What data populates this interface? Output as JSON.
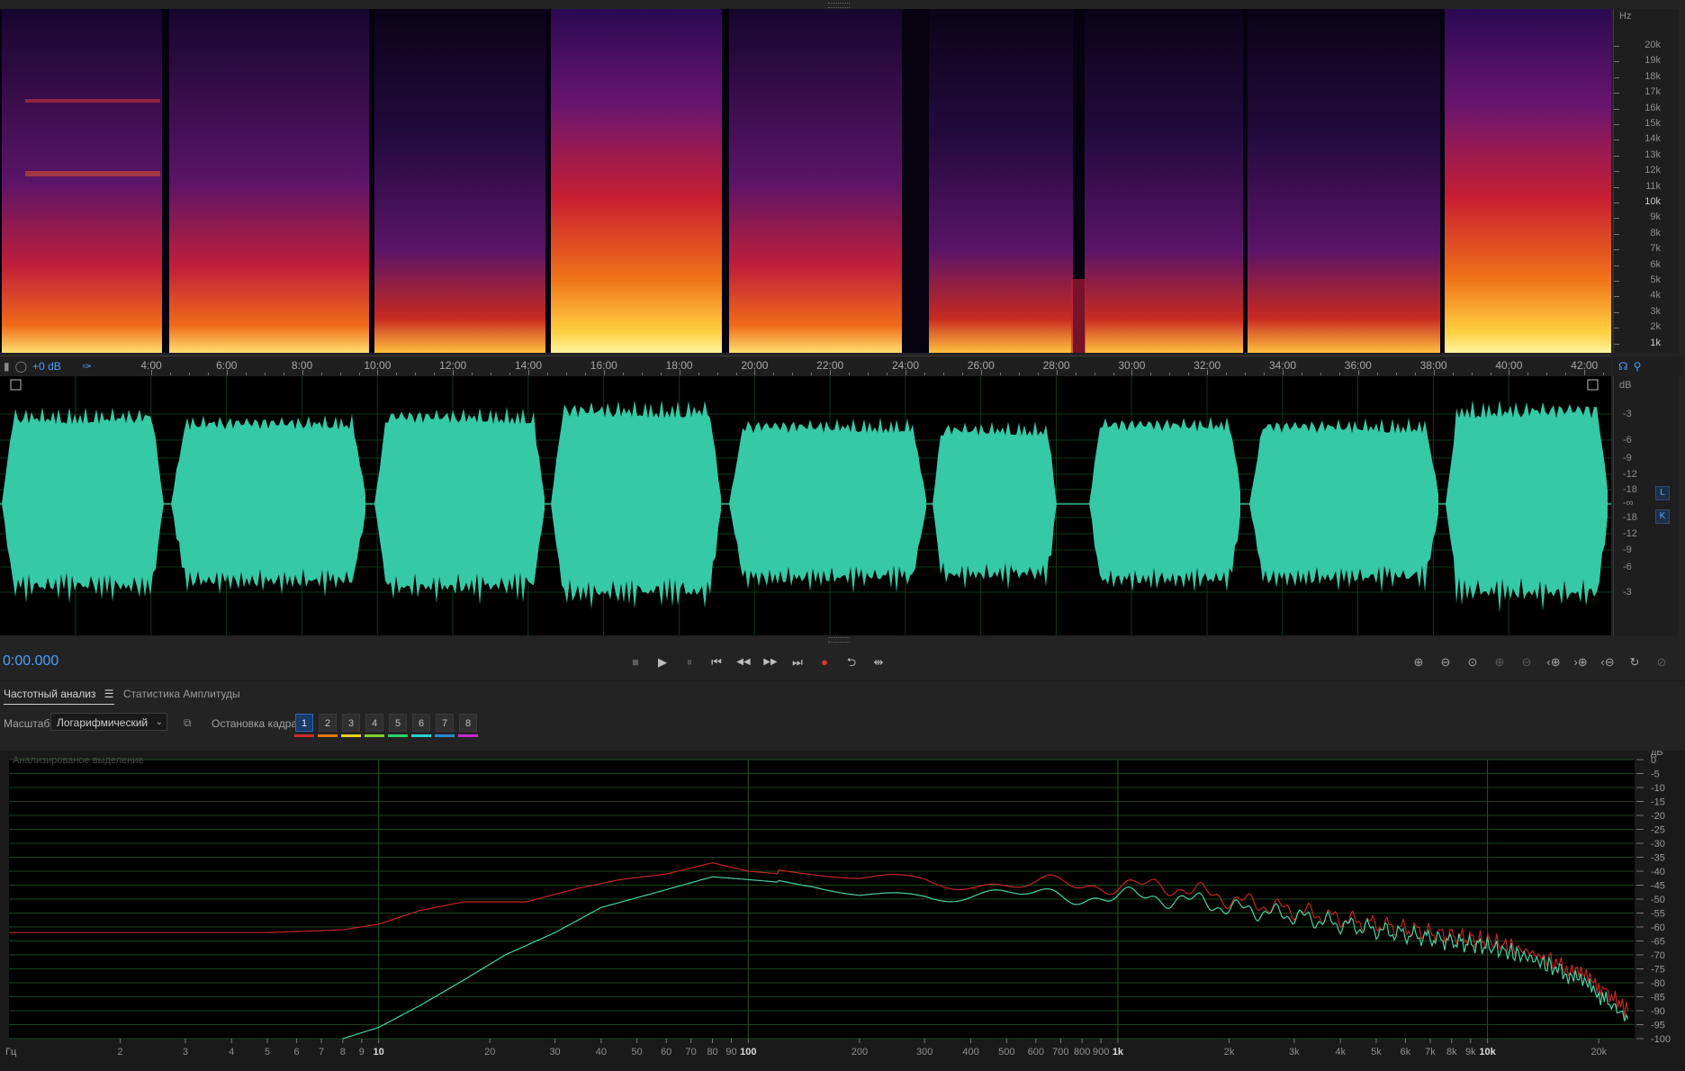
{
  "colors": {
    "accent": "#4a9fff",
    "waveform": "#35c9a5",
    "spectrum_red": "#c42525",
    "spectrum_green": "#4bd1a2"
  },
  "spectrogram": {
    "hz_unit": "Hz",
    "hz_labels": [
      "20k",
      "19k",
      "18k",
      "17k",
      "16k",
      "15k",
      "14k",
      "13k",
      "12k",
      "11k",
      "10k",
      "9k",
      "8k",
      "7k",
      "6k",
      "5k",
      "4k",
      "3k",
      "2k",
      "1k"
    ]
  },
  "timeline": {
    "gain": "+0 dB",
    "labels": [
      "4:00",
      "6:00",
      "8:00",
      "10:00",
      "12:00",
      "14:00",
      "16:00",
      "18:00",
      "20:00",
      "22:00",
      "24:00",
      "26:00",
      "28:00",
      "30:00",
      "32:00",
      "34:00",
      "36:00",
      "38:00",
      "40:00",
      "42:00"
    ]
  },
  "waveform": {
    "db_unit": "dB",
    "db_labels": [
      "-3",
      "-6",
      "-9",
      "-12",
      "-18",
      "-∞",
      "-18",
      "-12",
      "-9",
      "-6",
      "-3"
    ],
    "channels": [
      "L",
      "K"
    ]
  },
  "transport": {
    "timecode": "0:00.000",
    "buttons": [
      {
        "name": "stop-button",
        "glyph": "■"
      },
      {
        "name": "play-button",
        "glyph": "▶"
      },
      {
        "name": "pause-button",
        "glyph": "⏸"
      },
      {
        "name": "go-to-start-button",
        "glyph": "⏮"
      },
      {
        "name": "rewind-button",
        "glyph": "◀◀"
      },
      {
        "name": "fast-forward-button",
        "glyph": "▶▶"
      },
      {
        "name": "go-to-end-button",
        "glyph": "⏭"
      },
      {
        "name": "record-button",
        "glyph": "●"
      },
      {
        "name": "loop-button",
        "glyph": "⮌"
      },
      {
        "name": "skip-selection-button",
        "glyph": "⇹"
      }
    ],
    "zoom_buttons": [
      "zoom-in-amplitude-icon",
      "zoom-out-amplitude-icon",
      "zoom-reset-icon",
      "zoom-in-selection-icon",
      "zoom-out-selection-icon",
      "zoom-in-left-icon",
      "zoom-in-time-icon",
      "zoom-out-time-icon",
      "zoom-full-icon",
      "zoom-tool-icon"
    ]
  },
  "panel": {
    "tab_frequency": "Частотный анализ",
    "tab_amplitude": "Статистика Амплитуды",
    "scale_label": "Масштаб:",
    "scale_value": "Логарифмический",
    "freeze_label": "Остановка кадра:",
    "freeze_frames": [
      {
        "label": "1",
        "color": "#d12a2a",
        "active": true
      },
      {
        "label": "2",
        "color": "#e07a12",
        "active": false
      },
      {
        "label": "3",
        "color": "#e6d21a",
        "active": false
      },
      {
        "label": "4",
        "color": "#82d12a",
        "active": false
      },
      {
        "label": "5",
        "color": "#2ad16a",
        "active": false
      },
      {
        "label": "6",
        "color": "#2ad1d1",
        "active": false
      },
      {
        "label": "7",
        "color": "#2a8ad1",
        "active": false
      },
      {
        "label": "8",
        "color": "#c22ad1",
        "active": false
      }
    ]
  },
  "chart_data": {
    "type": "line",
    "title": "Анализированое выделение",
    "xlabel": "Гц",
    "ylabel": "дБ",
    "x_scale": "log",
    "xlim": [
      1,
      25000
    ],
    "ylim": [
      -100,
      0
    ],
    "x_ticks": [
      {
        "v": 2,
        "label": "2"
      },
      {
        "v": 3,
        "label": "3"
      },
      {
        "v": 4,
        "label": "4"
      },
      {
        "v": 5,
        "label": "5"
      },
      {
        "v": 6,
        "label": "6"
      },
      {
        "v": 7,
        "label": "7"
      },
      {
        "v": 8,
        "label": "8"
      },
      {
        "v": 9,
        "label": "9"
      },
      {
        "v": 10,
        "label": "10"
      },
      {
        "v": 20,
        "label": "20"
      },
      {
        "v": 30,
        "label": "30"
      },
      {
        "v": 40,
        "label": "40"
      },
      {
        "v": 50,
        "label": "50"
      },
      {
        "v": 60,
        "label": "60"
      },
      {
        "v": 70,
        "label": "70"
      },
      {
        "v": 80,
        "label": "80"
      },
      {
        "v": 90,
        "label": "90"
      },
      {
        "v": 100,
        "label": "100"
      },
      {
        "v": 200,
        "label": "200"
      },
      {
        "v": 300,
        "label": "300"
      },
      {
        "v": 400,
        "label": "400"
      },
      {
        "v": 500,
        "label": "500"
      },
      {
        "v": 600,
        "label": "600"
      },
      {
        "v": 700,
        "label": "700"
      },
      {
        "v": 800,
        "label": "800"
      },
      {
        "v": 900,
        "label": "900"
      },
      {
        "v": 1000,
        "label": "1k"
      },
      {
        "v": 2000,
        "label": "2k"
      },
      {
        "v": 3000,
        "label": "3k"
      },
      {
        "v": 4000,
        "label": "4k"
      },
      {
        "v": 5000,
        "label": "5k"
      },
      {
        "v": 6000,
        "label": "6k"
      },
      {
        "v": 7000,
        "label": "7k"
      },
      {
        "v": 8000,
        "label": "8k"
      },
      {
        "v": 9000,
        "label": "9k"
      },
      {
        "v": 10000,
        "label": "10k"
      },
      {
        "v": 20000,
        "label": "20k"
      }
    ],
    "y_ticks": [
      0,
      -5,
      -10,
      -15,
      -20,
      -25,
      -30,
      -35,
      -40,
      -45,
      -50,
      -55,
      -60,
      -65,
      -70,
      -75,
      -80,
      -85,
      -90,
      -95,
      -100
    ],
    "series": [
      {
        "color": "#c42525",
        "points": [
          [
            1,
            -62
          ],
          [
            5,
            -62
          ],
          [
            8,
            -61
          ],
          [
            10,
            -59
          ],
          [
            13,
            -54
          ],
          [
            17,
            -51
          ],
          [
            25,
            -51
          ],
          [
            35,
            -46
          ],
          [
            45,
            -43
          ],
          [
            60,
            -41
          ],
          [
            80,
            -37
          ],
          [
            100,
            -40
          ],
          [
            150,
            -42
          ],
          [
            200,
            -44
          ],
          [
            300,
            -42
          ],
          [
            500,
            -45
          ],
          [
            700,
            -45
          ],
          [
            1000,
            -45
          ],
          [
            1500,
            -46
          ],
          [
            2000,
            -50
          ],
          [
            3000,
            -54
          ],
          [
            4000,
            -57
          ],
          [
            5000,
            -59
          ],
          [
            7000,
            -62
          ],
          [
            10000,
            -65
          ],
          [
            13000,
            -69
          ],
          [
            16000,
            -74
          ],
          [
            20000,
            -81
          ],
          [
            24000,
            -90
          ]
        ]
      },
      {
        "color": "#4bd1a2",
        "points": [
          [
            8,
            -100
          ],
          [
            10,
            -96
          ],
          [
            13,
            -88
          ],
          [
            17,
            -79
          ],
          [
            22,
            -70
          ],
          [
            30,
            -62
          ],
          [
            40,
            -53
          ],
          [
            55,
            -48
          ],
          [
            80,
            -42
          ],
          [
            100,
            -43
          ],
          [
            150,
            -45
          ],
          [
            200,
            -48
          ],
          [
            300,
            -47
          ],
          [
            500,
            -49
          ],
          [
            700,
            -49
          ],
          [
            1000,
            -49
          ],
          [
            1500,
            -50
          ],
          [
            2000,
            -53
          ],
          [
            3000,
            -56
          ],
          [
            4000,
            -59
          ],
          [
            5000,
            -61
          ],
          [
            7000,
            -64
          ],
          [
            10000,
            -67
          ],
          [
            13000,
            -71
          ],
          [
            16000,
            -76
          ],
          [
            20000,
            -84
          ],
          [
            24000,
            -93
          ]
        ]
      }
    ]
  }
}
